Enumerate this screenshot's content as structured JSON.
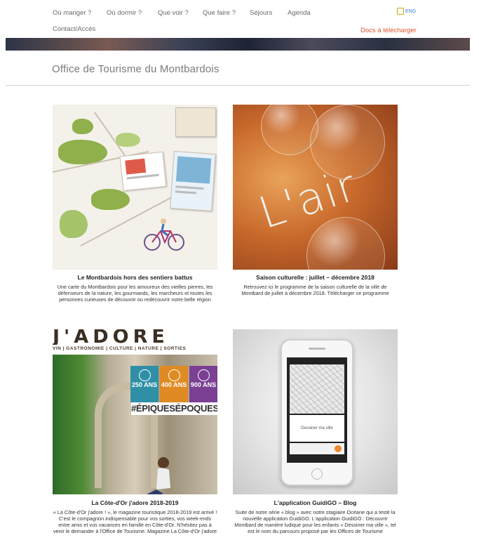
{
  "nav": {
    "items": [
      "Où manger ?",
      "Où dormir ?",
      "Que voir ?",
      "Que faire ?",
      "Séjours",
      "Agenda"
    ],
    "contact": "Contact/Accès",
    "docs": "Docs à télécharger",
    "lang": "ENG"
  },
  "site": {
    "title": "Office de Tourisme du Montbardois"
  },
  "cards": [
    {
      "title": "Le Montbardois hors des sentiers battus",
      "desc": "Une carte du Montbardois pour les amoureux des vieilles pierres, les défenseurs de la nature, les gourmands, les marcheurs et toutes les personnes curieuses de découvrir ou redécouvrir notre belle région"
    },
    {
      "title": "Saison culturelle : juillet – décembre 2018",
      "desc": "Retrouvez ici le programme de la saison culturelle de la ville de Montbard de juillet à décembre 2018. Télécharger ce programme",
      "image_text": "L'air"
    },
    {
      "title": "La Côte-d'Or j'adore 2018-2019",
      "desc": "« La Côte-d'Or j'adore ! », le magazine touristique 2018-2019 est arrivé ! C'est le compagnon indispensable pour vos sorties, vos week-ends entre amis et vos vacances en famille en Côte-d'Or. N'hésitez pas à venir le demander à l'Office de Tourisme. Magazine La Côte-d'Or j'adore",
      "mag_head": "J'ADORE",
      "mag_sub": "VIN | GASTRONOMIE | CULTURE | NATURE | SORTIES",
      "badges": [
        {
          "label": "250 ANS",
          "color": "#2f8fa6"
        },
        {
          "label": "400 ANS",
          "color": "#e08a23"
        },
        {
          "label": "900 ANS",
          "color": "#7b3f93"
        }
      ],
      "hashtag": "#ÉPIQUESÉPOQUES"
    },
    {
      "title": "L'application GuidiGO – Blog",
      "desc": "Suite de notre série « blog » avec notre stagiaire Océane qui a testé la nouvelle application GuidiGO. L'application GuidiGO : Découvrir Montbard de manière ludique pour les enfants « Dessiner ma ville », tel est le nom du parcours proposé par les Offices de Tourisme",
      "screen_text": "Dessiner ma ville"
    }
  ]
}
